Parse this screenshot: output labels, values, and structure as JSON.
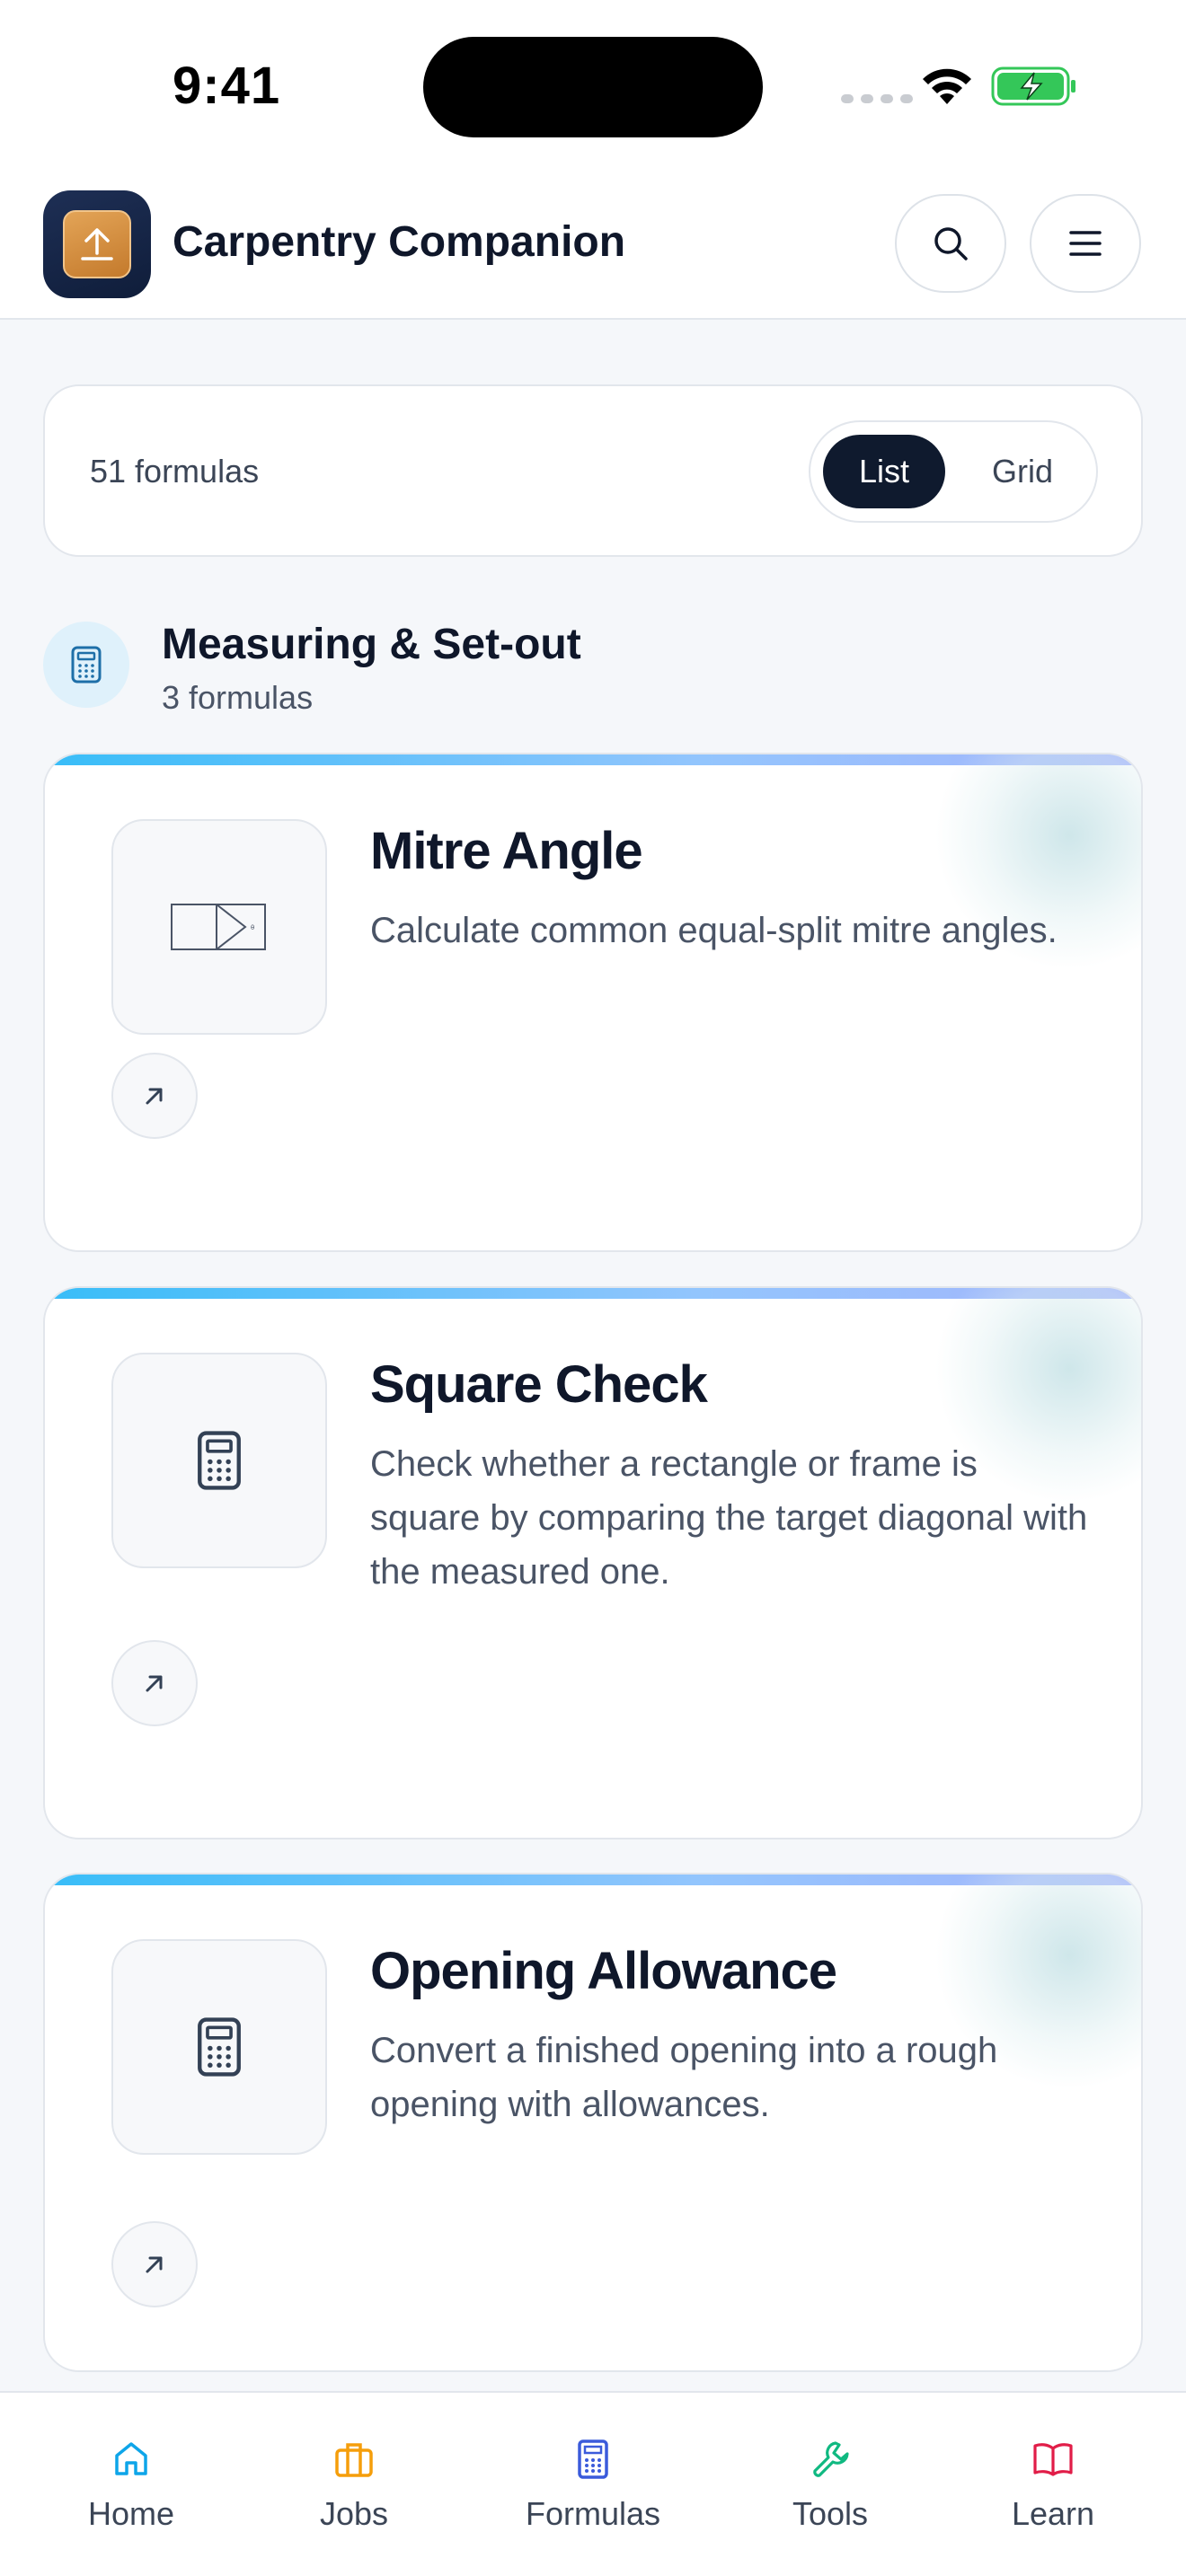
{
  "status_bar": {
    "time": "9:41"
  },
  "header": {
    "app_title": "Carpentry Companion",
    "logo_icon": "upload-box-icon",
    "search_icon": "search-icon",
    "menu_icon": "hamburger-menu-icon"
  },
  "summary": {
    "count_label": "51 formulas",
    "view_options": [
      "List",
      "Grid"
    ],
    "selected_view": "List"
  },
  "category": {
    "title": "Measuring & Set-out",
    "count_label": "3 formulas",
    "icon": "calculator-icon"
  },
  "formulas": [
    {
      "title": "Mitre Angle",
      "description": "Calculate common equal-split mitre angles.",
      "thumb_icon": "mitre-diagram-icon"
    },
    {
      "title": "Square Check",
      "description": "Check whether a rectangle or frame is square by comparing the target diagonal with the measured one.",
      "thumb_icon": "calculator-icon"
    },
    {
      "title": "Opening Allowance",
      "description": "Convert a finished opening into a rough opening with allowances.",
      "thumb_icon": "calculator-icon"
    }
  ],
  "bottom_nav": {
    "items": [
      {
        "label": "Home",
        "icon": "home-icon",
        "color": "#0ea5e9"
      },
      {
        "label": "Jobs",
        "icon": "briefcase-icon",
        "color": "#f59e0b"
      },
      {
        "label": "Formulas",
        "icon": "calculator-icon",
        "color": "#3b5bdb"
      },
      {
        "label": "Tools",
        "icon": "wrench-icon",
        "color": "#10b981"
      },
      {
        "label": "Learn",
        "icon": "book-icon",
        "color": "#e11d48"
      }
    ]
  },
  "colors": {
    "primary_dark": "#0f1a2e",
    "accent_gradient_start": "#38bdf8",
    "accent_gradient_end": "#a5b4fc",
    "text_muted": "#4a5466"
  }
}
